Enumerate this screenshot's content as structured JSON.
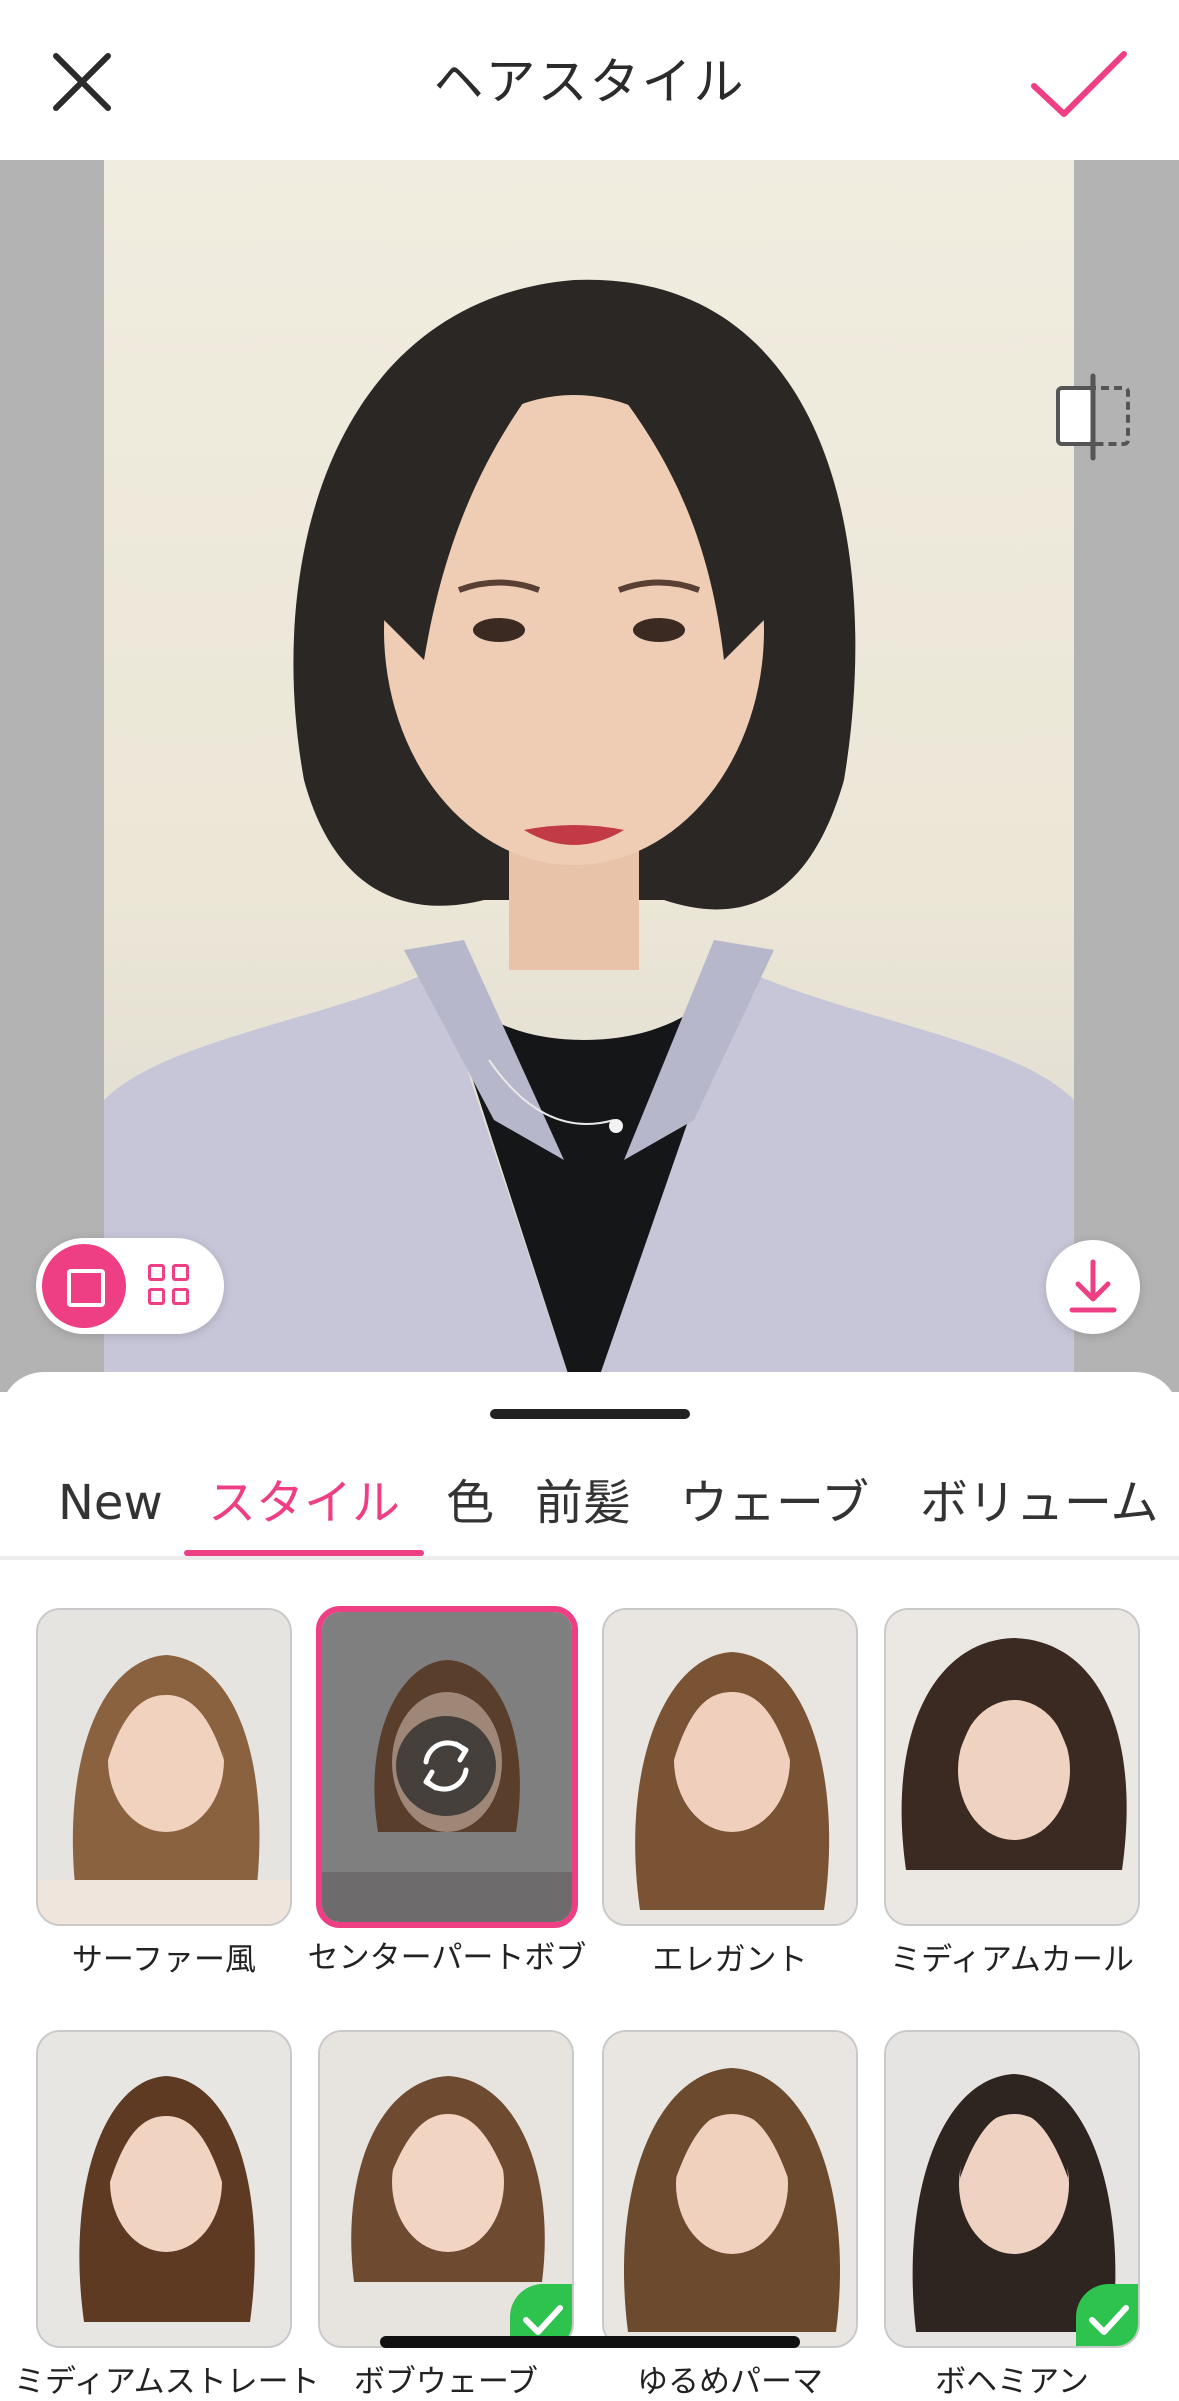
{
  "header": {
    "title": "ヘアスタイル",
    "close_icon": "close-icon",
    "confirm_icon": "checkmark-icon",
    "accent_color": "#ee3f84"
  },
  "canvas": {
    "compare_icon": "compare-split-icon",
    "view_modes": [
      "single-view-icon",
      "grid-view-icon"
    ],
    "selected_view": "single-view-icon",
    "download_icon": "download-icon"
  },
  "tabs": {
    "items": [
      "New",
      "スタイル",
      "色",
      "前髪",
      "ウェーブ",
      "ボリューム"
    ],
    "active": "スタイル"
  },
  "styles": {
    "items": [
      {
        "label": "サーファー風",
        "selected": false,
        "applied": false
      },
      {
        "label": "センターパートボブ",
        "selected": true,
        "applied": false
      },
      {
        "label": "エレガント",
        "selected": false,
        "applied": false
      },
      {
        "label": "ミディアムカール",
        "selected": false,
        "applied": false
      },
      {
        "label": "ミディアムストレート",
        "selected": false,
        "applied": false
      },
      {
        "label": "ボブウェーブ",
        "selected": false,
        "applied": true
      },
      {
        "label": "ゆるめパーマ",
        "selected": false,
        "applied": false
      },
      {
        "label": "ボヘミアン",
        "selected": false,
        "applied": true
      }
    ],
    "reroll_icon": "refresh-icon",
    "applied_badge_color": "#2ec24f"
  }
}
